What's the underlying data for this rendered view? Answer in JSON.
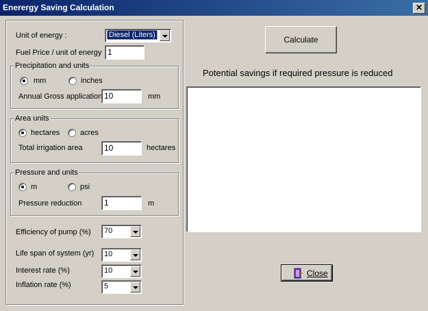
{
  "window": {
    "title": "Enerergy Saving Calculation",
    "close_glyph": "✕"
  },
  "energy": {
    "unit_label": "Unit of energy :",
    "unit_value": "Diesel (Liters)",
    "price_label": "Fuel Price / unit of energy",
    "price_value": "1"
  },
  "precip": {
    "legend": "Precipitation and units",
    "opt_mm": "mm",
    "opt_inches": "inches",
    "selected": "mm",
    "gross_label": "Annual Gross application",
    "gross_value": "10",
    "gross_unit": "mm"
  },
  "area": {
    "legend": "Area units",
    "opt_hectares": "hectares",
    "opt_acres": "acres",
    "selected": "hectares",
    "total_label": "Total irrigation area",
    "total_value": "10",
    "total_unit": "hectares"
  },
  "pressure": {
    "legend": "Pressure and  units",
    "opt_m": "m",
    "opt_psi": "psi",
    "selected": "m",
    "reduction_label": "Pressure reduction",
    "reduction_value": "1",
    "reduction_unit": "m"
  },
  "params": {
    "efficiency_label": "Efficiency of pump (%)",
    "efficiency_value": "70",
    "lifespan_label": "Life span of system (yr)",
    "lifespan_value": "10",
    "interest_label": "Interest rate (%)",
    "interest_value": "10",
    "inflation_label": "Inflation rate (%)",
    "inflation_value": "5"
  },
  "actions": {
    "calculate_label": "Calculate",
    "close_label": "Close"
  },
  "results": {
    "heading": "Potential savings if required pressure is reduced",
    "text": ""
  },
  "icons": {
    "close_button_icon": "door-exit-icon"
  },
  "colors": {
    "titlebar_start": "#0a246a",
    "titlebar_end": "#3a6ea5",
    "face": "#d4d0c8"
  }
}
